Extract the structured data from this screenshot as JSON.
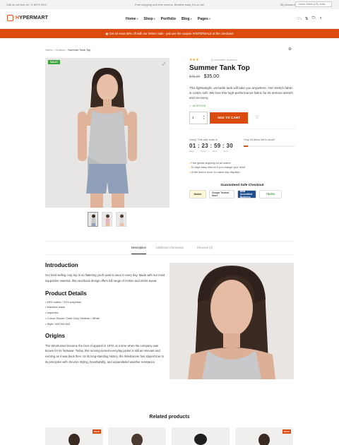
{
  "topbar": {
    "phone": "Call us toll free on +1 8979 0911",
    "shipping": "Free shipping and free returns. Breathe easy, it's on us!",
    "account": "My Account",
    "currency": "United States (US) dollar"
  },
  "header": {
    "logo_h": "H",
    "logo_rest": "YPERMART",
    "nav": [
      "Home",
      "Shop",
      "Portfolio",
      "Blog",
      "Pages"
    ],
    "wishlist_count": "0",
    "cart_count": "0"
  },
  "promo": {
    "text": "Get an extra 50% off with our Winter Sale - just use the coupon WINTERSALE at the checkout!"
  },
  "breadcrumb": {
    "home": "Home",
    "category": "Outdoor",
    "current": "Summer Tank Top"
  },
  "product": {
    "sale_badge": "SALE!",
    "stars": "★★★",
    "reviews": "(2 customer reviews)",
    "title": "Summer Tank Top",
    "old_price": "$45.00",
    "new_price": "$35.00",
    "description": "This lightweight, versatile tank will take you anywhere. Our stretch fabric is cotton soft. We love this high-performance fabric for its serious stretch and recovery.",
    "stock": "✓  IN STOCK",
    "qty": "1",
    "add_to_cart": "ADD TO CART",
    "hurry_text": "Hurry! This sale ends in",
    "countdown": "01 : 23 : 59 : 30",
    "units": [
      "Days",
      "Hours",
      "Mins",
      "Secs"
    ],
    "stock_left_text": "Only 18 items left in stock!",
    "stock_level_pct": 8,
    "bullets": [
      "Free global shipping on all orders",
      "30 days easy returns if you change your mind",
      "Order before noon for same day dispatch"
    ],
    "safe_checkout_title": "Guaranteed Safe Checkout",
    "trust_logos": [
      "Norton",
      "Google Trusted Store",
      "BBB Accredited Business",
      "TRUSTe"
    ]
  },
  "tabs": [
    "Description",
    "Additional information",
    "Reviews (2)"
  ],
  "details": {
    "intro_title": "Introduction",
    "intro_text": "Our best-selling crop top is so flattering you'll want to wear it every day. Made with our most supportive material, this racerback design offers full range of motion and wicks sweat.",
    "details_title": "Product Details",
    "details_list": [
      "69% cotton / 31% polyester",
      "Machine-wash",
      "Imported",
      "Colour Shown: Dark Grey Heather / White",
      "Style: 930769-063"
    ],
    "origins_title": "Origins",
    "origins_text": "The Windrunner became the face of apparel in 1978, at a time when the company was known for its footwear. Today, this running-turned-everyday jacket is still as relevant and exciting as it was back then. Its its long-standing history, the Windrunner has stayed true to its principles with chevron styling, breathability, and unparalleled weather resistance."
  },
  "related": {
    "title": "Related products",
    "badges": [
      "SALE!",
      "SALE!"
    ]
  }
}
